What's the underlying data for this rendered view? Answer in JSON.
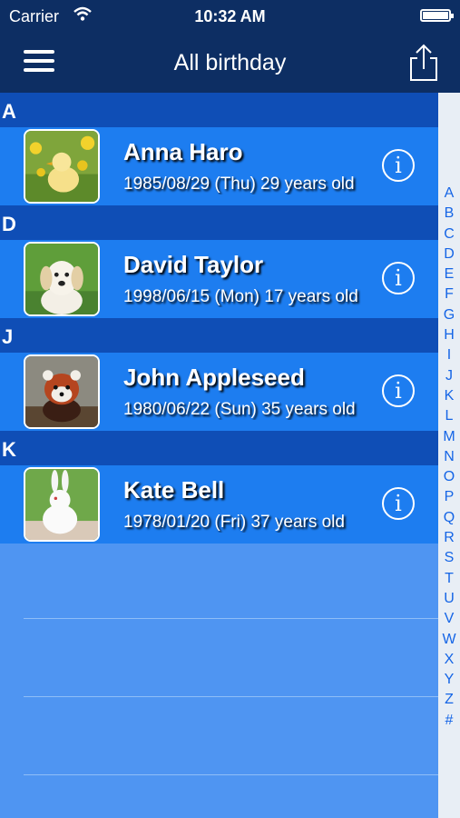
{
  "status_bar": {
    "carrier": "Carrier",
    "time": "10:32 AM"
  },
  "nav": {
    "title": "All birthday",
    "menu_icon": "hamburger-menu-icon",
    "share_icon": "share-icon"
  },
  "sections": [
    {
      "letter": "A",
      "contacts": [
        {
          "name": "Anna Haro",
          "detail": "1985/08/29 (Thu) 29 years old",
          "photo": "duckling"
        }
      ]
    },
    {
      "letter": "D",
      "contacts": [
        {
          "name": "David Taylor",
          "detail": "1998/06/15 (Mon) 17 years old",
          "photo": "puppy"
        }
      ]
    },
    {
      "letter": "J",
      "contacts": [
        {
          "name": "John Appleseed",
          "detail": "1980/06/22 (Sun) 35 years old",
          "photo": "red-panda"
        }
      ]
    },
    {
      "letter": "K",
      "contacts": [
        {
          "name": "Kate Bell",
          "detail": "1978/01/20 (Fri) 37 years old",
          "photo": "rabbit"
        }
      ]
    }
  ],
  "index_letters": [
    "A",
    "B",
    "C",
    "D",
    "E",
    "F",
    "G",
    "H",
    "I",
    "J",
    "K",
    "L",
    "M",
    "N",
    "O",
    "P",
    "Q",
    "R",
    "S",
    "T",
    "U",
    "V",
    "W",
    "X",
    "Y",
    "Z",
    "#"
  ],
  "colors": {
    "nav_bg": "#0d2e63",
    "section_bg": "#0f4eb6",
    "row_bg": "#1d7df0",
    "empty_bg": "#4f95f2",
    "index_text": "#1565e6"
  }
}
